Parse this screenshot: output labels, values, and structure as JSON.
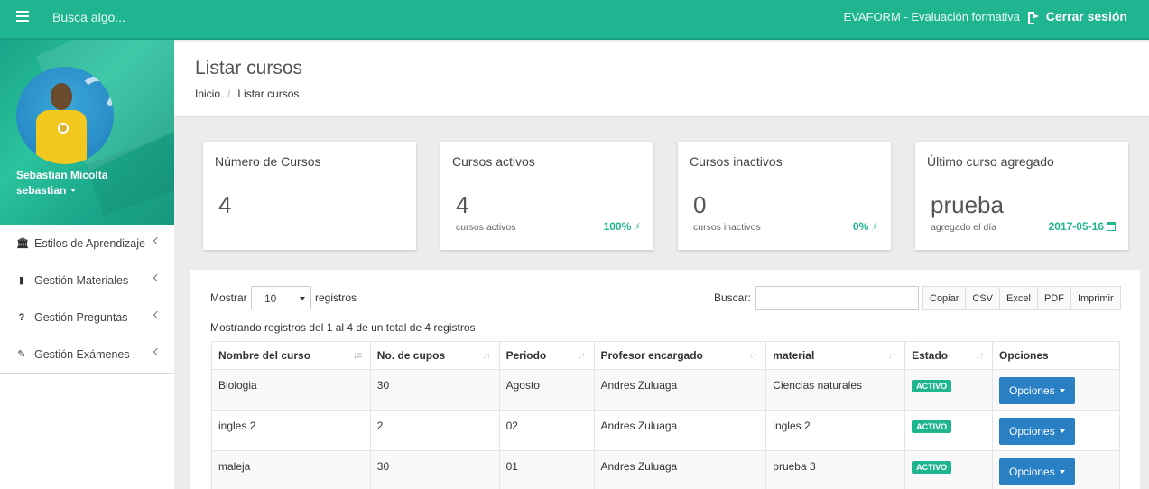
{
  "topbar": {
    "search_placeholder": "Busca algo...",
    "app_name": "EVAFORM - Evaluación formativa",
    "logout_label": "Cerrar sesión"
  },
  "sidebar": {
    "profile_name": "Sebastian Micolta",
    "profile_user": "sebastian",
    "items": [
      {
        "label": "Estilos de Aprendizaje",
        "icon": "bank-icon"
      },
      {
        "label": "Gestión Materiales",
        "icon": "book-icon"
      },
      {
        "label": "Gestión Preguntas",
        "icon": "question-icon"
      },
      {
        "label": "Gestión Exámenes",
        "icon": "pencil-icon"
      }
    ]
  },
  "header": {
    "title": "Listar cursos",
    "breadcrumb": [
      "Inicio",
      "Listar cursos"
    ]
  },
  "cards": [
    {
      "title": "Número de Cursos",
      "value": "4",
      "sub": "",
      "right": ""
    },
    {
      "title": "Cursos activos",
      "value": "4",
      "sub": "cursos activos",
      "right": "100%"
    },
    {
      "title": "Cursos inactivos",
      "value": "0",
      "sub": "cursos inactivos",
      "right": "0%"
    },
    {
      "title": "Último curso agregado",
      "value": "prueba",
      "sub": "agregado el día",
      "right": "2017-05-16"
    }
  ],
  "table_controls": {
    "show_label": "Mostrar",
    "page_size": "10",
    "records_label": "registros",
    "search_label": "Buscar:",
    "search_value": "",
    "export_buttons": [
      "Copiar",
      "CSV",
      "Excel",
      "PDF",
      "Imprimir"
    ],
    "info": "Mostrando registros del 1 al 4 de un total de 4 registros"
  },
  "table": {
    "headers": [
      "Nombre del curso",
      "No. de cupos",
      "Periodo",
      "Profesor encargado",
      "material",
      "Estado",
      "Opciones"
    ],
    "rows": [
      {
        "name": "Biologia",
        "cupos": "30",
        "periodo": "Agosto",
        "profesor": "Andres Zuluaga",
        "material": "Ciencias naturales",
        "estado": "ACTIVO",
        "opciones": "Opciones"
      },
      {
        "name": "ingles 2",
        "cupos": "2",
        "periodo": "02",
        "profesor": "Andres Zuluaga",
        "material": "ingles 2",
        "estado": "ACTIVO",
        "opciones": "Opciones"
      },
      {
        "name": "maleja",
        "cupos": "30",
        "periodo": "01",
        "profesor": "Andres Zuluaga",
        "material": "prueba 3",
        "estado": "ACTIVO",
        "opciones": "Opciones"
      }
    ]
  },
  "colors": {
    "accent": "#1fb591",
    "button_primary": "#2a80c5"
  }
}
